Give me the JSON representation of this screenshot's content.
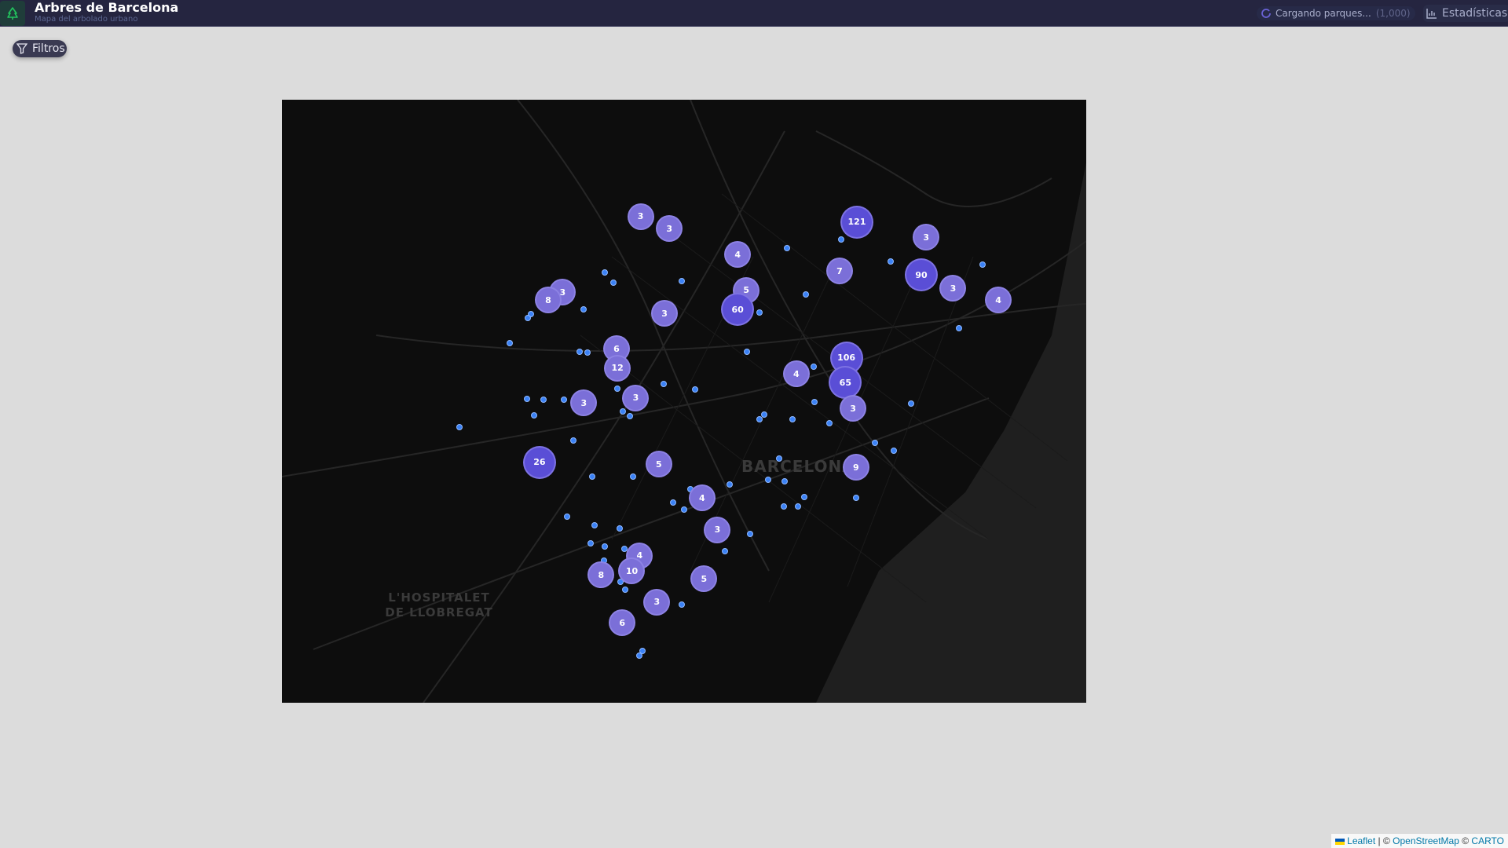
{
  "header": {
    "title": "Arbres de Barcelona",
    "subtitle": "Mapa del arbolado urbano",
    "loading_text": "Cargando parques...",
    "loading_count": "(1,000)",
    "stats_label": "Estadísticas"
  },
  "filters": {
    "label": "Filtros"
  },
  "map": {
    "labels": {
      "city": "BARCELONA",
      "hospitalet": "L'HOSPITALET DE LLOBREGAT"
    },
    "clusters": [
      3,
      3,
      121,
      3,
      4,
      7,
      90,
      3,
      8,
      5,
      3,
      4,
      60,
      3,
      6,
      12,
      106,
      4,
      65,
      3,
      3,
      3,
      26,
      5,
      9,
      4,
      3,
      4,
      10,
      8,
      5,
      3,
      6
    ],
    "colors": {
      "cluster_small": "#7b6fd8",
      "cluster_large": "#5a4ed6",
      "marker": "#3b82f6"
    }
  },
  "attribution": {
    "leaflet": "Leaflet",
    "sep": "| ©",
    "osm": "OpenStreetMap",
    "carto_prefix": "©",
    "carto": "CARTO"
  }
}
